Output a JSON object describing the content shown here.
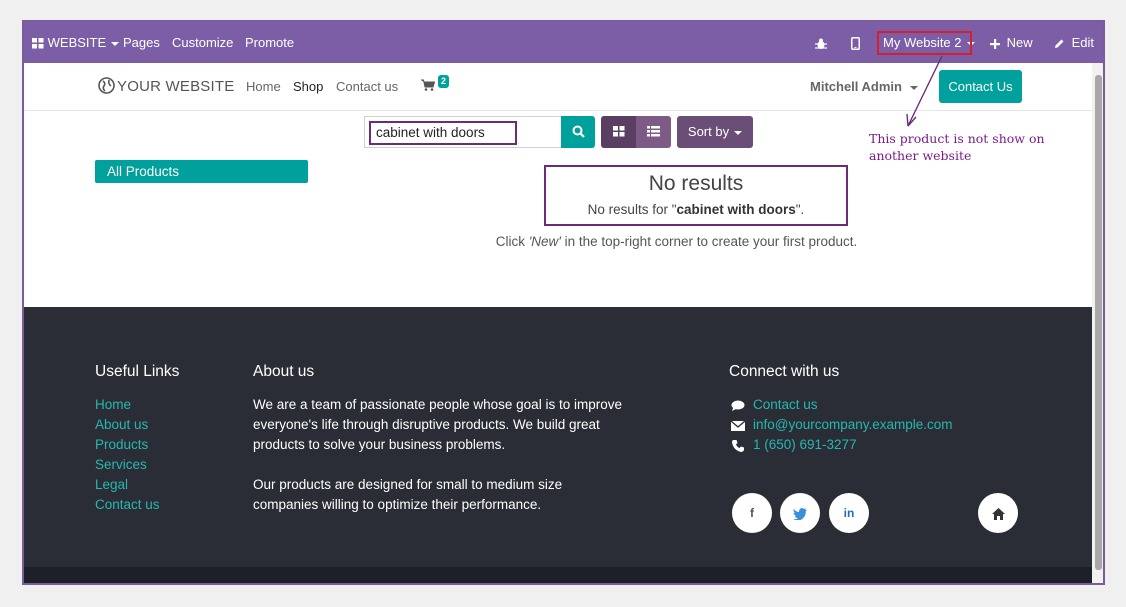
{
  "topbar": {
    "website_menu": "WEBSITE",
    "pages": "Pages",
    "customize": "Customize",
    "promote": "Promote",
    "current_website": "My Website 2",
    "new": "New",
    "edit": "Edit"
  },
  "header": {
    "logo": "YOUR WEBSITE",
    "nav": [
      "Home",
      "Shop",
      "Contact us"
    ],
    "cart_count": "2",
    "user": "Mitchell Admin",
    "contact_button": "Contact Us"
  },
  "shop": {
    "search_value": "cabinet with doors",
    "sort_label": "Sort by",
    "category": "All Products",
    "no_results_title": "No results",
    "no_results_prefix": "No results for \"",
    "no_results_term": "cabinet with doors",
    "no_results_suffix": "\".",
    "hint_prefix": "Click ",
    "hint_new": "'New'",
    "hint_suffix": " in the top-right corner to create your first product."
  },
  "annotation": {
    "line1": "This product is not show on",
    "line2": "another website"
  },
  "footer": {
    "useful_links_title": "Useful Links",
    "useful_links": [
      "Home",
      "About us",
      "Products",
      "Services",
      "Legal",
      "Contact us"
    ],
    "about_title": "About us",
    "about_lines": [
      "We are a team of passionate people whose goal is to improve",
      "everyone's life through disruptive products. We build great",
      "products to solve your business problems.",
      "",
      "Our products are designed for small to medium size",
      "companies willing to optimize their performance."
    ],
    "connect_title": "Connect with us",
    "connect_links": [
      "Contact us",
      "info@yourcompany.example.com",
      "1 (650) 691-3277"
    ],
    "social": [
      "f",
      "in"
    ]
  },
  "colors": {
    "topbar": "#7c5ea6",
    "accent": "#00a09d",
    "annotation": "#6b2c77",
    "footer": "#2a2d35"
  }
}
